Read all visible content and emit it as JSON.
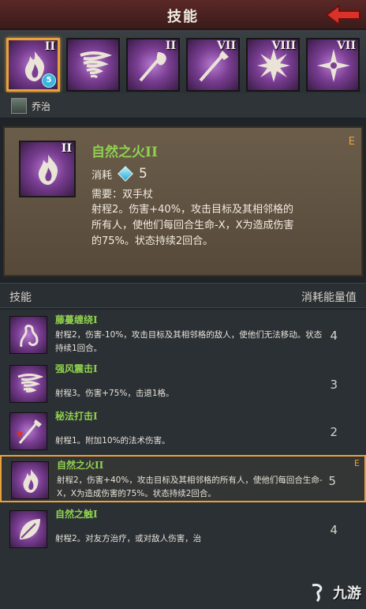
{
  "header": {
    "title": "技能"
  },
  "skillbar": {
    "slots": [
      {
        "roman": "II",
        "icon": "flame-icon",
        "selected": true,
        "badge": "5"
      },
      {
        "roman": "",
        "icon": "whirlwind-icon",
        "selected": false
      },
      {
        "roman": "II",
        "icon": "leaf-spear-icon",
        "selected": false
      },
      {
        "roman": "VII",
        "icon": "spear-icon",
        "selected": false
      },
      {
        "roman": "VIII",
        "icon": "burst-icon",
        "selected": false
      },
      {
        "roman": "VII",
        "icon": "compass-star-icon",
        "selected": false
      }
    ]
  },
  "character": {
    "name": "乔治"
  },
  "detail": {
    "title": "自然之火",
    "title_roman": "II",
    "roman": "II",
    "grade": "E",
    "cost_label": "消耗",
    "cost_value": "5",
    "requirement": "需要：双手杖",
    "description": "射程2。伤害+40%，攻击目标及其相邻格的所有人，使他们每回合生命-X，X为造成伤害的75%。状态持续2回合。"
  },
  "section": {
    "left_label": "技能",
    "right_label": "消耗能量值"
  },
  "skills": [
    {
      "name": "藤蔓缠绕",
      "roman": "I",
      "icon": "vine-icon",
      "desc": "射程2，伤害-10%，攻击目标及其相邻格的敌人，使他们无法移动。状态持续1回合。",
      "cost": "4",
      "grade": ""
    },
    {
      "name": "强风震击",
      "roman": "I",
      "icon": "whirlwind-icon",
      "desc": "射程3。伤害+75%，击退1格。",
      "cost": "3",
      "grade": ""
    },
    {
      "name": "秘法打击",
      "roman": "I",
      "icon": "arcane-strike-icon",
      "desc": "射程1。附加10%的法术伤害。",
      "cost": "2",
      "grade": ""
    },
    {
      "name": "自然之火",
      "roman": "II",
      "icon": "flame-icon",
      "desc": "射程2，伤害+40%，攻击目标及其相邻格的所有人，使他们每回合生命-X，X为造成伤害的75%。状态持续2回合。",
      "cost": "5",
      "grade": "E"
    },
    {
      "name": "自然之触",
      "roman": "I",
      "icon": "leaf-icon",
      "desc": "射程2。对友方治疗，或对敌人伤害，治",
      "cost": "4",
      "grade": ""
    }
  ],
  "watermark": {
    "text": "九游"
  }
}
